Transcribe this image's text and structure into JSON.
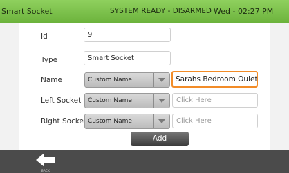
{
  "header": {
    "title": "Smart Socket",
    "status": "SYSTEM READY - DISARMED",
    "clock": "Wed - 02:27 PM",
    "color": "#7cc24a"
  },
  "form": {
    "id": {
      "label": "Id",
      "value": "9"
    },
    "type": {
      "label": "Type",
      "value": "Smart Socket"
    },
    "name": {
      "label": "Name",
      "dropdown": "Custom Name",
      "value": "Sarahs Bedroom Oulets"
    },
    "left_socket": {
      "label": "Left Socket",
      "dropdown": "Custom Name",
      "placeholder": "Click Here"
    },
    "right_socket": {
      "label": "Right Socket",
      "dropdown": "Custom Name",
      "placeholder": "Click Here"
    }
  },
  "actions": {
    "add_label": "Add"
  },
  "footer": {
    "back_label": "BACK",
    "back_icon": "arrow-left-icon"
  },
  "colors": {
    "focus_border": "#f28c28",
    "footer_bg": "#4b4b4b"
  }
}
